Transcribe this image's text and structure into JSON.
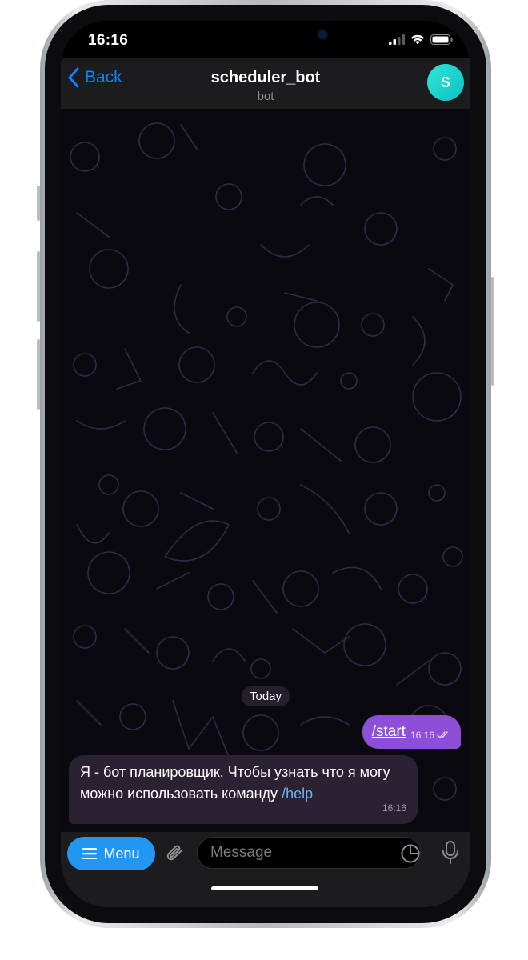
{
  "status_bar": {
    "time": "16:16"
  },
  "header": {
    "back_label": "Back",
    "title": "scheduler_bot",
    "subtitle": "bot",
    "avatar_letter": "S",
    "avatar_color": "#1cd3cf"
  },
  "chat": {
    "date_chip": "Today",
    "messages": [
      {
        "direction": "outgoing",
        "text": "/start",
        "time": "16:16",
        "status": "read"
      },
      {
        "direction": "incoming",
        "text_before_link": "Я - бот планировщик. Чтобы узнать что я могу можно использовать команду",
        "link": "/help",
        "time": "16:16"
      }
    ]
  },
  "composer": {
    "menu_label": "Menu",
    "placeholder": "Message"
  },
  "colors": {
    "accent": "#0a84ff",
    "outgoing_bubble": "#8e4fd8",
    "incoming_bubble": "#2a2132",
    "link": "#6ab3f3",
    "menu_button": "#2196f3"
  }
}
